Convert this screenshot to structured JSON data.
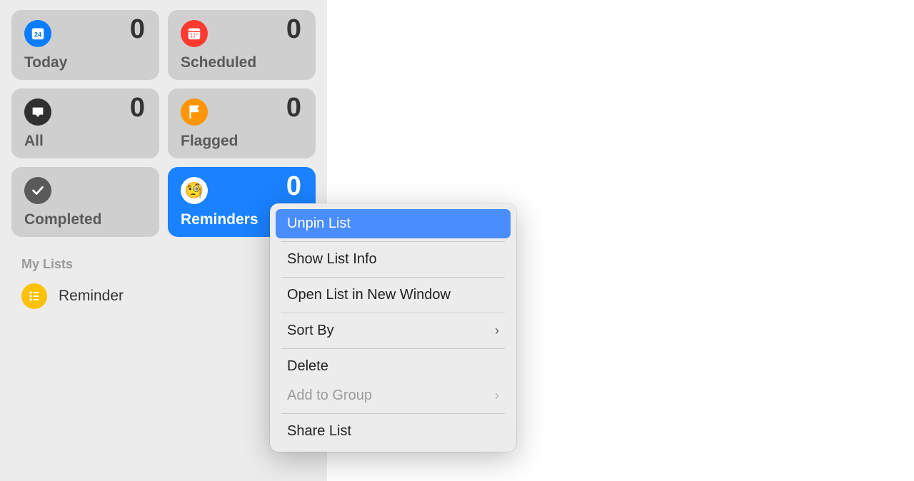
{
  "colors": {
    "accent_blue": "#1a82ff",
    "orange": "#ff9500",
    "red": "#ff3b30",
    "yellow": "#ffc107"
  },
  "sidebar": {
    "smart_lists": {
      "today": {
        "label": "Today",
        "count": 0
      },
      "scheduled": {
        "label": "Scheduled",
        "count": 0
      },
      "all": {
        "label": "All",
        "count": 0
      },
      "flagged": {
        "label": "Flagged",
        "count": 0
      },
      "completed": {
        "label": "Completed"
      },
      "reminders": {
        "label": "Reminders",
        "count": 0
      }
    },
    "my_lists_header": "My Lists",
    "lists": [
      {
        "name": "Reminder"
      }
    ]
  },
  "context_menu": {
    "items": {
      "unpin": "Unpin List",
      "info": "Show List Info",
      "open_new_window": "Open List in New Window",
      "sort_by": "Sort By",
      "delete": "Delete",
      "add_to_group": "Add to Group",
      "share": "Share List"
    }
  }
}
